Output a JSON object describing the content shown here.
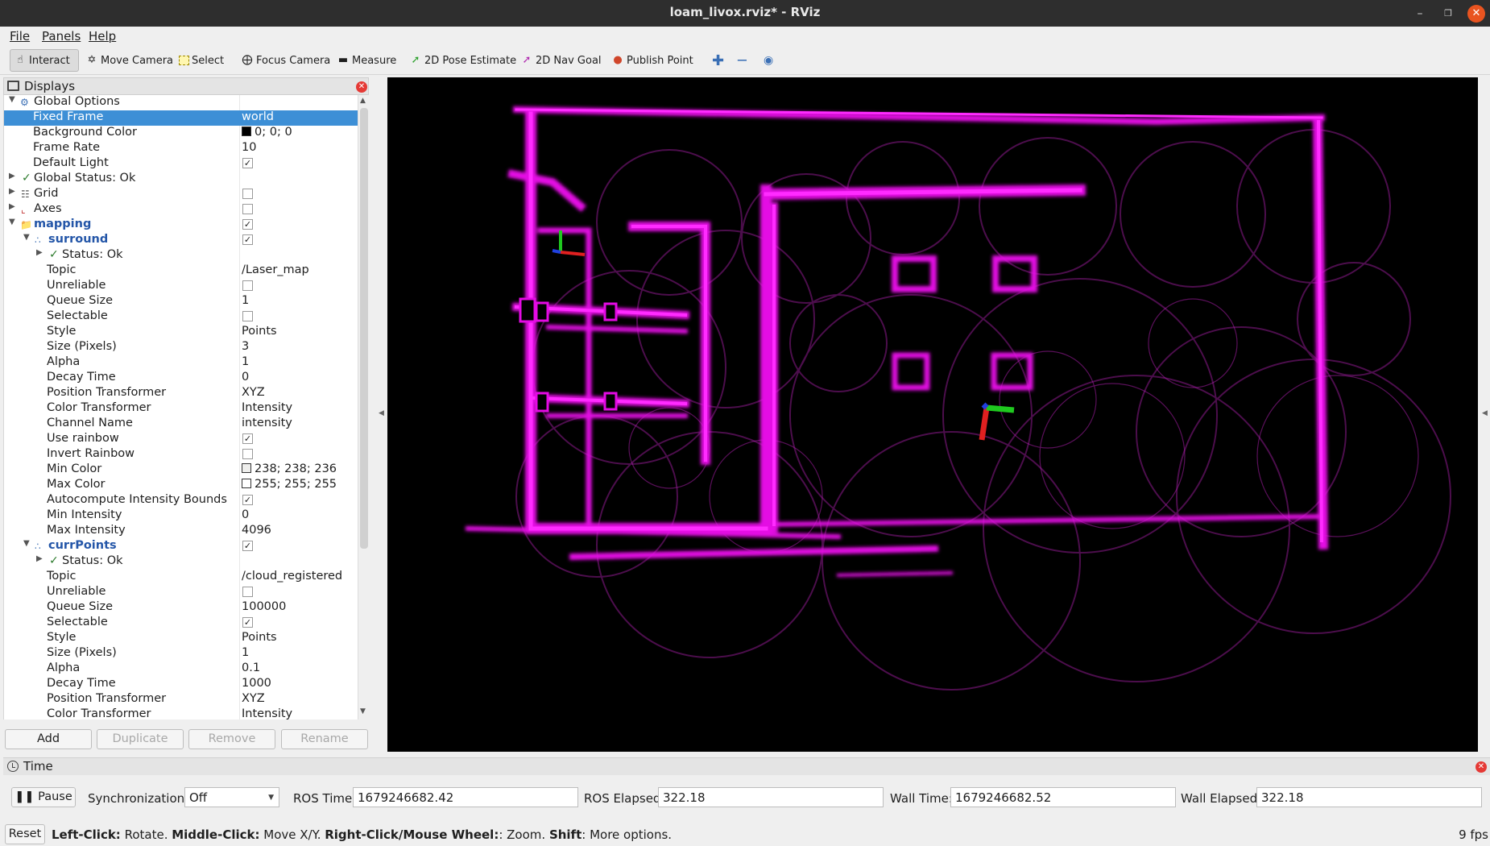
{
  "window": {
    "title": "loam_livox.rviz* - RViz"
  },
  "menu": [
    "File",
    "Panels",
    "Help"
  ],
  "toolbar": {
    "tools": [
      {
        "label": "Interact",
        "icon": "cursor-hand-icon",
        "active": true
      },
      {
        "label": "Move Camera",
        "icon": "move-camera-icon"
      },
      {
        "label": "Select",
        "icon": "select-icon"
      },
      {
        "label": "Focus Camera",
        "icon": "focus-camera-icon"
      },
      {
        "label": "Measure",
        "icon": "ruler-icon"
      },
      {
        "label": "2D Pose Estimate",
        "icon": "green-arrow-icon"
      },
      {
        "label": "2D Nav Goal",
        "icon": "purple-arrow-icon"
      },
      {
        "label": "Publish Point",
        "icon": "pin-icon"
      }
    ]
  },
  "displays": {
    "title": "Displays",
    "rows": [
      {
        "name": "Global Options",
        "value": ""
      },
      {
        "name": "Fixed Frame",
        "value": "world"
      },
      {
        "name": "Background Color",
        "value": "0; 0; 0"
      },
      {
        "name": "Frame Rate",
        "value": "10"
      },
      {
        "name": "Default Light",
        "value": ""
      },
      {
        "name": "Global Status: Ok",
        "value": ""
      },
      {
        "name": "Grid",
        "value": ""
      },
      {
        "name": "Axes",
        "value": ""
      },
      {
        "name": "mapping",
        "value": ""
      },
      {
        "name": "surround",
        "value": ""
      },
      {
        "name": "Status: Ok",
        "value": ""
      },
      {
        "name": "Topic",
        "value": "/Laser_map"
      },
      {
        "name": "Unreliable",
        "value": ""
      },
      {
        "name": "Queue Size",
        "value": "1"
      },
      {
        "name": "Selectable",
        "value": ""
      },
      {
        "name": "Style",
        "value": "Points"
      },
      {
        "name": "Size (Pixels)",
        "value": "3"
      },
      {
        "name": "Alpha",
        "value": "1"
      },
      {
        "name": "Decay Time",
        "value": "0"
      },
      {
        "name": "Position Transformer",
        "value": "XYZ"
      },
      {
        "name": "Color Transformer",
        "value": "Intensity"
      },
      {
        "name": "Channel Name",
        "value": "intensity"
      },
      {
        "name": "Use rainbow",
        "value": ""
      },
      {
        "name": "Invert Rainbow",
        "value": ""
      },
      {
        "name": "Min Color",
        "value": "238; 238; 236"
      },
      {
        "name": "Max Color",
        "value": "255; 255; 255"
      },
      {
        "name": "Autocompute Intensity Bounds",
        "value": ""
      },
      {
        "name": "Min Intensity",
        "value": "0"
      },
      {
        "name": "Max Intensity",
        "value": "4096"
      },
      {
        "name": "currPoints",
        "value": ""
      },
      {
        "name": "Status: Ok",
        "value": ""
      },
      {
        "name": "Topic",
        "value": "/cloud_registered"
      },
      {
        "name": "Unreliable",
        "value": ""
      },
      {
        "name": "Queue Size",
        "value": "100000"
      },
      {
        "name": "Selectable",
        "value": ""
      },
      {
        "name": "Style",
        "value": "Points"
      },
      {
        "name": "Size (Pixels)",
        "value": "1"
      },
      {
        "name": "Alpha",
        "value": "0.1"
      },
      {
        "name": "Decay Time",
        "value": "1000"
      },
      {
        "name": "Position Transformer",
        "value": "XYZ"
      },
      {
        "name": "Color Transformer",
        "value": "Intensity"
      }
    ],
    "buttons": {
      "add": "Add",
      "duplicate": "Duplicate",
      "remove": "Remove",
      "rename": "Rename"
    }
  },
  "viewport": {
    "background": "#000000",
    "point_color": "#e000e0"
  },
  "time": {
    "title": "Time",
    "pause_label": "Pause",
    "sync_label": "Synchronization:",
    "sync_value": "Off",
    "ros_time_label": "ROS Time:",
    "ros_time": "1679246682.42",
    "ros_elapsed_label": "ROS Elapsed:",
    "ros_elapsed": "322.18",
    "wall_time_label": "Wall Time:",
    "wall_time": "1679246682.52",
    "wall_elapsed_label": "Wall Elapsed:",
    "wall_elapsed": "322.18"
  },
  "status": {
    "reset_label": "Reset",
    "hint_1b": "Left-Click:",
    "hint_1": " Rotate. ",
    "hint_2b": "Middle-Click:",
    "hint_2": " Move X/Y. ",
    "hint_3b": "Right-Click/Mouse Wheel:",
    "hint_3": ": Zoom. ",
    "hint_4b": "Shift",
    "hint_4": ": More options.",
    "fps": "9 fps"
  }
}
